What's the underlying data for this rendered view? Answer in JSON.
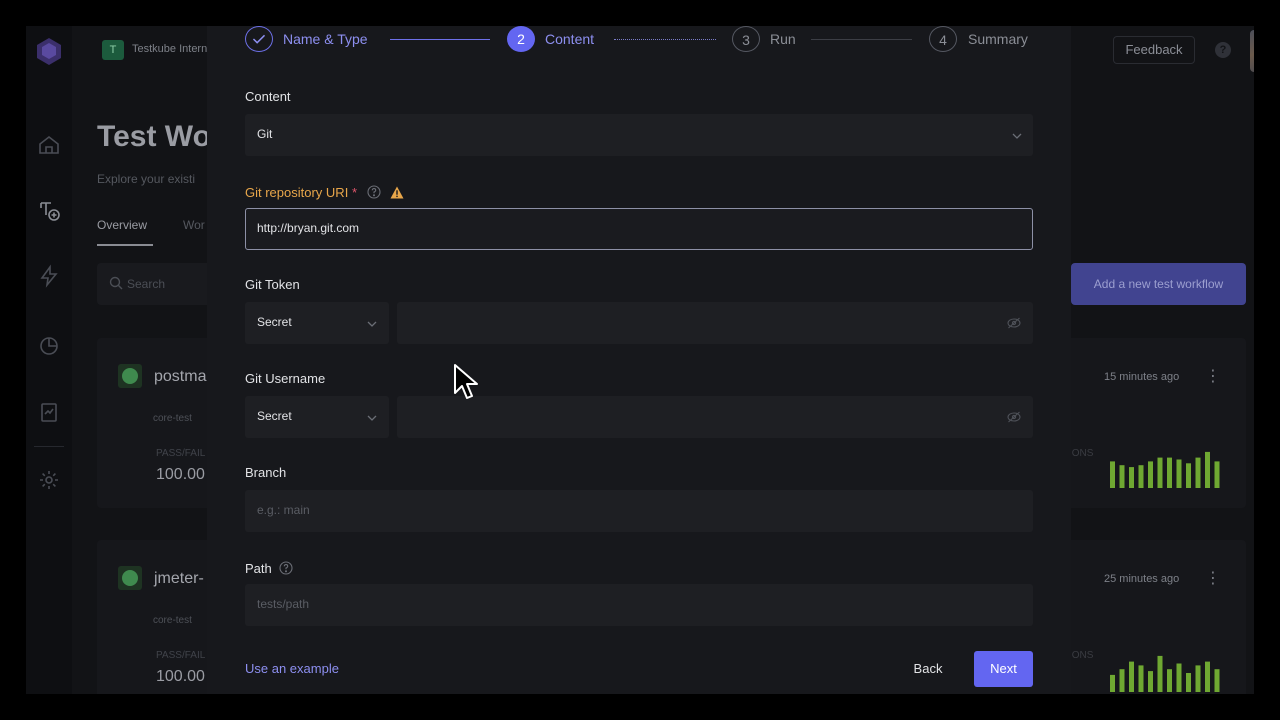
{
  "org": {
    "badge": "T",
    "name": "Testkube Intern"
  },
  "header": {
    "feedback_label": "Feedback",
    "help_symbol": "?"
  },
  "page": {
    "title": "Test Wo",
    "subtitle": "Explore your existi",
    "tabs": [
      {
        "label": "Overview",
        "active": true
      },
      {
        "label": "Wor",
        "active": false
      }
    ],
    "search_placeholder": "Search",
    "add_button_label": "Add a new test workflow"
  },
  "workflows": [
    {
      "name": "postma",
      "tag": "core-test",
      "metric_label": "PASS/FAIL",
      "metric_value": "100.00",
      "time": "15 minutes ago",
      "exec_label": "IONS",
      "bar_heights": [
        0.7,
        0.6,
        0.55,
        0.6,
        0.7,
        0.8,
        0.8,
        0.75,
        0.65,
        0.8,
        0.95,
        0.7
      ]
    },
    {
      "name": "jmeter-",
      "tag": "core-test",
      "metric_label": "PASS/FAIL",
      "metric_value": "100.00",
      "time": "25 minutes ago",
      "exec_label": "IONS",
      "bar_heights": [
        0.45,
        0.6,
        0.8,
        0.7,
        0.55,
        0.95,
        0.6,
        0.75,
        0.5,
        0.7,
        0.8,
        0.6
      ]
    }
  ],
  "wizard": {
    "steps": [
      {
        "number": "",
        "label": "Name & Type",
        "state": "done"
      },
      {
        "number": "2",
        "label": "Content",
        "state": "active"
      },
      {
        "number": "3",
        "label": "Run",
        "state": "pending"
      },
      {
        "number": "4",
        "label": "Summary",
        "state": "pending"
      }
    ],
    "content": {
      "label": "Content",
      "value": "Git"
    },
    "git_uri": {
      "label": "Git repository URI",
      "required_mark": "*",
      "value": "http://bryan.git.com"
    },
    "git_token": {
      "label": "Git Token",
      "select_value": "Secret",
      "value": ""
    },
    "git_username": {
      "label": "Git Username",
      "select_value": "Secret",
      "value": ""
    },
    "branch": {
      "label": "Branch",
      "placeholder": "e.g.: main"
    },
    "path": {
      "label": "Path",
      "placeholder": "tests/path"
    },
    "example_link": "Use an example",
    "back_label": "Back",
    "next_label": "Next"
  },
  "colors": {
    "accent": "#6366f1",
    "warning": "#e8a64a",
    "required": "#e0566b",
    "success": "#3f8a4e",
    "bar": "#6fa832"
  }
}
